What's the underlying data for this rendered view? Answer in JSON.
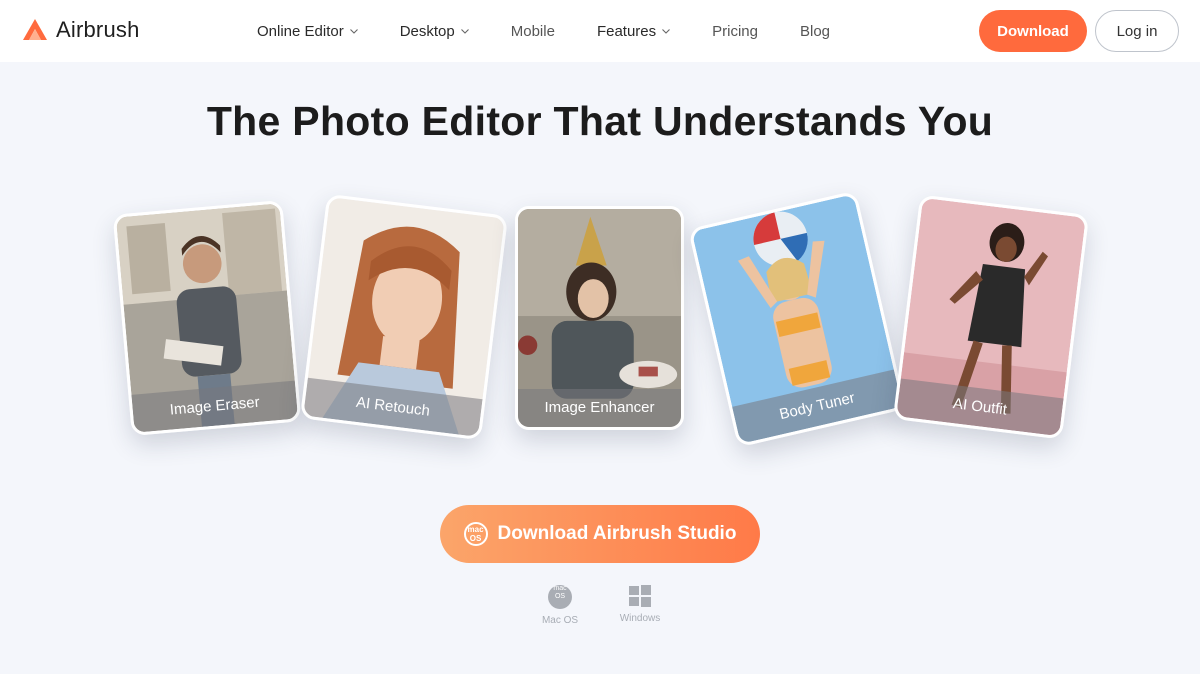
{
  "brand": {
    "name": "Airbrush",
    "accent": "#ff6a3d"
  },
  "nav": {
    "items": [
      {
        "label": "Online Editor",
        "dropdown": true
      },
      {
        "label": "Desktop",
        "dropdown": true
      },
      {
        "label": "Mobile",
        "dropdown": false
      },
      {
        "label": "Features",
        "dropdown": true
      },
      {
        "label": "Pricing",
        "dropdown": false
      },
      {
        "label": "Blog",
        "dropdown": false
      }
    ],
    "download_label": "Download",
    "login_label": "Log in"
  },
  "hero": {
    "title": "The Photo Editor That Understands You",
    "cards": [
      {
        "label": "Image Eraser"
      },
      {
        "label": "AI Retouch"
      },
      {
        "label": "Image Enhancer"
      },
      {
        "label": "Body Tuner"
      },
      {
        "label": "AI Outfit"
      }
    ],
    "cta_label": "Download Airbrush Studio",
    "cta_icon_text": "mac OS",
    "platforms": [
      {
        "label": "Mac OS",
        "icon": "macos-icon",
        "badge": "mac OS"
      },
      {
        "label": "Windows",
        "icon": "windows-icon"
      }
    ]
  }
}
